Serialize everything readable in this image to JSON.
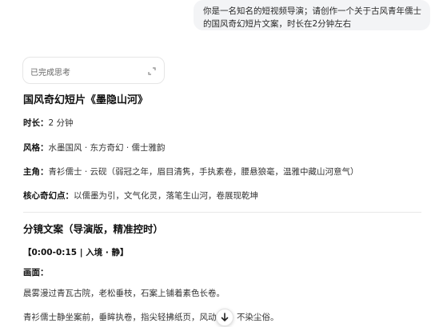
{
  "user_message": {
    "line1": "你是一名知名的短视频导演；请创作一个关于古风青年儒士",
    "line2": "的国风奇幻短片文案，时长在2分钟左右"
  },
  "thinking": {
    "label": "已完成思考",
    "icon": "expand-icon"
  },
  "answer": {
    "title": "国风奇幻短片《墨隐山河》",
    "meta": [
      {
        "key": "时长：",
        "value": "2 分钟"
      },
      {
        "key": "风格：",
        "value": "水墨国风 · 东方奇幻 · 儒士雅韵"
      },
      {
        "key": "主角：",
        "value": "青衫儒士 · 云砚（弱冠之年，眉目清隽，手执素卷，腰悬狼毫，温雅中藏山河意气）"
      },
      {
        "key": "核心奇幻点：",
        "value": "以儒墨为引，文气化灵，落笔生山河，卷展现乾坤"
      }
    ],
    "section_title": "分镜文案（导演版，精准控时）",
    "segment": "【0:00-0:15 | 入境 · 静】",
    "scene_label": "画面：",
    "paragraphs": [
      "晨雾漫过青瓦古院，老松垂枝，石案上铺着素色长卷。",
      "青衫儒士静坐案前，垂眸执卷，指尖轻拂纸页，风动衣",
      "不染尘俗。"
    ]
  },
  "scroll_button": {
    "icon": "arrow-down-icon"
  }
}
